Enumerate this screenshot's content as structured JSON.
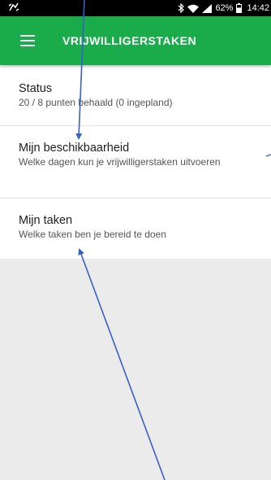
{
  "status_bar": {
    "battery_percent": "62%",
    "time": "14:42",
    "left_icon": "app-notification-icon",
    "icons": [
      "bluetooth-icon",
      "wifi-icon",
      "signal-icon",
      "battery-icon"
    ]
  },
  "app_bar": {
    "title": "VRIJWILLIGERSTAKEN",
    "menu_icon": "hamburger-menu-icon",
    "color": "#1aab4a"
  },
  "list": {
    "items": [
      {
        "title": "Status",
        "subtitle": "20 / 8 punten behaald (0 ingepland)"
      },
      {
        "title": "Mijn beschikbaarheid",
        "subtitle": "Welke dagen kun je vrijwilligerstaken uitvoeren"
      },
      {
        "title": "Mijn taken",
        "subtitle": "Welke taken ben je bereid te doen"
      }
    ]
  },
  "colors": {
    "accent": "#1aab4a",
    "annotation_arrow": "#3a5fc8",
    "background": "#ebebeb"
  }
}
